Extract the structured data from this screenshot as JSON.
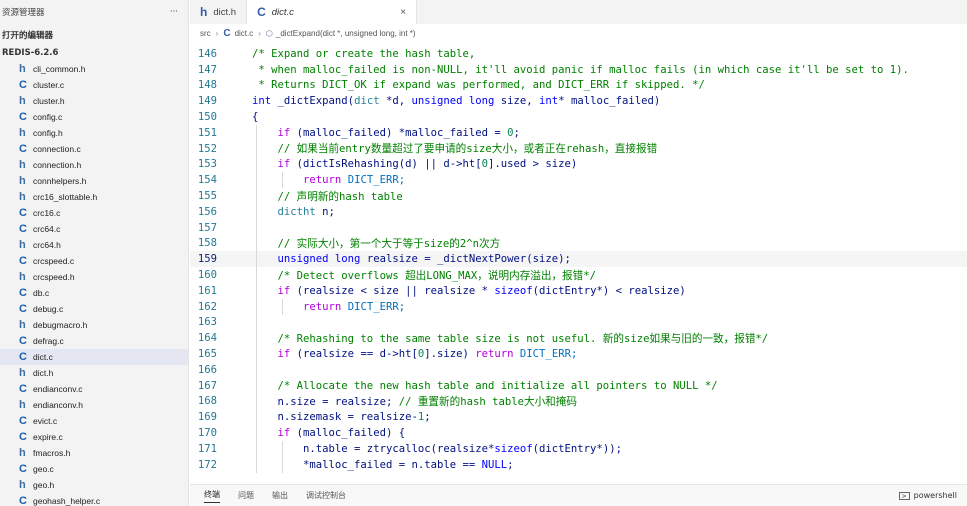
{
  "sidebar": {
    "header": "资源管理器",
    "more": "···",
    "open_editors": "打开的编辑器",
    "project": "REDIS-6.2.6",
    "files": [
      {
        "type": "h",
        "name": "cli_common.h"
      },
      {
        "type": "c",
        "name": "cluster.c"
      },
      {
        "type": "h",
        "name": "cluster.h"
      },
      {
        "type": "c",
        "name": "config.c"
      },
      {
        "type": "h",
        "name": "config.h"
      },
      {
        "type": "c",
        "name": "connection.c"
      },
      {
        "type": "h",
        "name": "connection.h"
      },
      {
        "type": "h",
        "name": "connhelpers.h"
      },
      {
        "type": "h",
        "name": "crc16_slottable.h"
      },
      {
        "type": "c",
        "name": "crc16.c"
      },
      {
        "type": "c",
        "name": "crc64.c"
      },
      {
        "type": "h",
        "name": "crc64.h"
      },
      {
        "type": "c",
        "name": "crcspeed.c"
      },
      {
        "type": "h",
        "name": "crcspeed.h"
      },
      {
        "type": "c",
        "name": "db.c"
      },
      {
        "type": "c",
        "name": "debug.c"
      },
      {
        "type": "h",
        "name": "debugmacro.h"
      },
      {
        "type": "c",
        "name": "defrag.c"
      },
      {
        "type": "c",
        "name": "dict.c",
        "active": true
      },
      {
        "type": "h",
        "name": "dict.h"
      },
      {
        "type": "c",
        "name": "endianconv.c"
      },
      {
        "type": "h",
        "name": "endianconv.h"
      },
      {
        "type": "c",
        "name": "evict.c"
      },
      {
        "type": "c",
        "name": "expire.c"
      },
      {
        "type": "h",
        "name": "fmacros.h"
      },
      {
        "type": "c",
        "name": "geo.c"
      },
      {
        "type": "h",
        "name": "geo.h"
      },
      {
        "type": "c",
        "name": "geohash_helper.c"
      }
    ]
  },
  "tabs": [
    {
      "icon": "h",
      "label": "dict.h",
      "active": false
    },
    {
      "icon": "C",
      "label": "dict.c",
      "active": true,
      "close": "×"
    }
  ],
  "breadcrumb": {
    "folder": "src",
    "file_icon": "C",
    "file": "dict.c",
    "symbol": "_dictExpand(dict *, unsigned long, int *)"
  },
  "editor": {
    "current_line": 159,
    "lines": [
      {
        "n": 146,
        "indent": 0,
        "tokens": [
          {
            "t": "/* Expand or create the hash table,",
            "c": "#008000"
          }
        ]
      },
      {
        "n": 147,
        "indent": 0,
        "tokens": [
          {
            "t": " * when malloc_failed is non-NULL, it'll avoid panic if malloc fails (in which case it'll be set to 1).",
            "c": "#008000"
          }
        ]
      },
      {
        "n": 148,
        "indent": 0,
        "tokens": [
          {
            "t": " * Returns DICT_OK if expand was performed, and DICT_ERR if skipped. */",
            "c": "#008000"
          }
        ]
      },
      {
        "n": 149,
        "indent": 0,
        "tokens": [
          {
            "t": "int",
            "c": "#0000ff"
          },
          {
            "t": " _dictExpand(",
            "c": "#001080"
          },
          {
            "t": "dict",
            "c": "#267f99"
          },
          {
            "t": " *d, ",
            "c": "#001080"
          },
          {
            "t": "unsigned long",
            "c": "#0000ff"
          },
          {
            "t": " size, ",
            "c": "#001080"
          },
          {
            "t": "int",
            "c": "#0000ff"
          },
          {
            "t": "* malloc_failed)",
            "c": "#001080"
          }
        ]
      },
      {
        "n": 150,
        "indent": 0,
        "tokens": [
          {
            "t": "{",
            "c": "#001080"
          }
        ]
      },
      {
        "n": 151,
        "indent": 1,
        "tokens": [
          {
            "t": "if",
            "c": "#af00db"
          },
          {
            "t": " (malloc_failed) *malloc_failed = ",
            "c": "#001080"
          },
          {
            "t": "0",
            "c": "#098658"
          },
          {
            "t": ";",
            "c": "#001080"
          }
        ]
      },
      {
        "n": 152,
        "indent": 1,
        "tokens": [
          {
            "t": "// 如果当前entry数量超过了要申请的size大小，或者正在rehash，直接报错",
            "c": "#008000"
          }
        ]
      },
      {
        "n": 153,
        "indent": 1,
        "tokens": [
          {
            "t": "if",
            "c": "#af00db"
          },
          {
            "t": " (dictIsRehashing(d) || d->ht[",
            "c": "#001080"
          },
          {
            "t": "0",
            "c": "#098658"
          },
          {
            "t": "].used > size)",
            "c": "#001080"
          }
        ]
      },
      {
        "n": 154,
        "indent": 2,
        "tokens": [
          {
            "t": "return",
            "c": "#af00db"
          },
          {
            "t": " DICT_ERR;",
            "c": "#0070c1"
          }
        ]
      },
      {
        "n": 155,
        "indent": 1,
        "tokens": [
          {
            "t": "// 声明新的hash table",
            "c": "#008000"
          }
        ]
      },
      {
        "n": 156,
        "indent": 1,
        "tokens": [
          {
            "t": "dictht",
            "c": "#267f99"
          },
          {
            "t": " n;",
            "c": "#001080"
          }
        ]
      },
      {
        "n": 157,
        "indent": 1,
        "tokens": []
      },
      {
        "n": 158,
        "indent": 1,
        "tokens": [
          {
            "t": "// 实际大小，第一个大于等于size的2^n次方",
            "c": "#008000"
          }
        ]
      },
      {
        "n": 159,
        "indent": 1,
        "tokens": [
          {
            "t": "unsigned long",
            "c": "#0000ff"
          },
          {
            "t": " realsize = _dictNextPower(size);",
            "c": "#001080"
          }
        ]
      },
      {
        "n": 160,
        "indent": 1,
        "tokens": [
          {
            "t": "/* Detect overflows 超出LONG_MAX，说明内存溢出，报错*/",
            "c": "#008000"
          }
        ]
      },
      {
        "n": 161,
        "indent": 1,
        "tokens": [
          {
            "t": "if",
            "c": "#af00db"
          },
          {
            "t": " (realsize < size || realsize * ",
            "c": "#001080"
          },
          {
            "t": "sizeof",
            "c": "#0000ff"
          },
          {
            "t": "(dictEntry*) < realsize)",
            "c": "#001080"
          }
        ]
      },
      {
        "n": 162,
        "indent": 2,
        "tokens": [
          {
            "t": "return",
            "c": "#af00db"
          },
          {
            "t": " DICT_ERR;",
            "c": "#0070c1"
          }
        ]
      },
      {
        "n": 163,
        "indent": 1,
        "tokens": []
      },
      {
        "n": 164,
        "indent": 1,
        "tokens": [
          {
            "t": "/* Rehashing to the same table size is not useful. 新的size如果与旧的一致，报错*/",
            "c": "#008000"
          }
        ]
      },
      {
        "n": 165,
        "indent": 1,
        "tokens": [
          {
            "t": "if",
            "c": "#af00db"
          },
          {
            "t": " (realsize == d->ht[",
            "c": "#001080"
          },
          {
            "t": "0",
            "c": "#098658"
          },
          {
            "t": "].size) ",
            "c": "#001080"
          },
          {
            "t": "return",
            "c": "#af00db"
          },
          {
            "t": " DICT_ERR;",
            "c": "#0070c1"
          }
        ]
      },
      {
        "n": 166,
        "indent": 1,
        "tokens": []
      },
      {
        "n": 167,
        "indent": 1,
        "tokens": [
          {
            "t": "/* Allocate the new hash table and initialize all pointers to NULL */",
            "c": "#008000"
          }
        ]
      },
      {
        "n": 168,
        "indent": 1,
        "tokens": [
          {
            "t": "n.size = realsize; ",
            "c": "#001080"
          },
          {
            "t": "// 重置新的hash table大小和掩码",
            "c": "#008000"
          }
        ]
      },
      {
        "n": 169,
        "indent": 1,
        "tokens": [
          {
            "t": "n.sizemask = realsize-",
            "c": "#001080"
          },
          {
            "t": "1",
            "c": "#098658"
          },
          {
            "t": ";",
            "c": "#001080"
          }
        ]
      },
      {
        "n": 170,
        "indent": 1,
        "tokens": [
          {
            "t": "if",
            "c": "#af00db"
          },
          {
            "t": " (malloc_failed) {",
            "c": "#001080"
          }
        ]
      },
      {
        "n": 171,
        "indent": 2,
        "tokens": [
          {
            "t": "n.table = ztrycalloc(realsize*",
            "c": "#001080"
          },
          {
            "t": "sizeof",
            "c": "#0000ff"
          },
          {
            "t": "(dictEntry*));",
            "c": "#001080"
          }
        ]
      },
      {
        "n": 172,
        "indent": 2,
        "tokens": [
          {
            "t": "*malloc_failed = n.table == ",
            "c": "#001080"
          },
          {
            "t": "NULL",
            "c": "#0000ff"
          },
          {
            "t": ";",
            "c": "#001080"
          }
        ]
      }
    ]
  },
  "panel": {
    "tabs": [
      "终端",
      "问题",
      "输出",
      "调试控制台"
    ],
    "active_tab": "终端",
    "terminal": "powershell"
  },
  "colors": {
    "accent": "#2f5fa8",
    "line_number": "#237893",
    "comment": "#008000",
    "keyword": "#0000ff",
    "control": "#af00db"
  }
}
